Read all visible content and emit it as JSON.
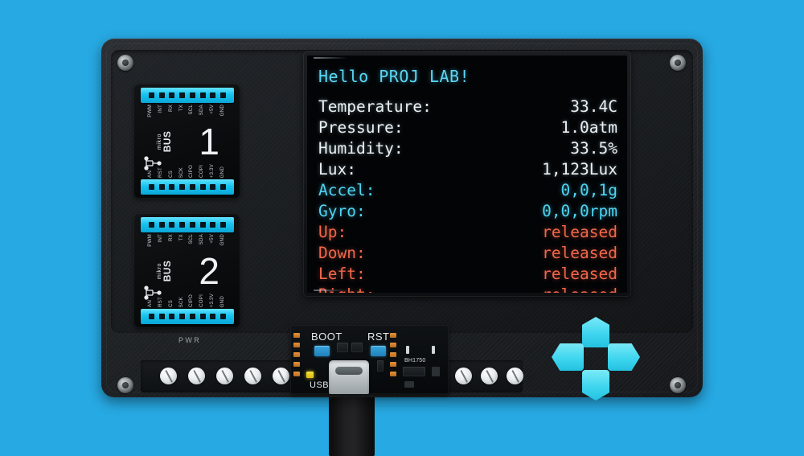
{
  "scene": {
    "background_color": "#27a9e3",
    "device_label": "3d-printed-dev-board-enclosure"
  },
  "display": {
    "title": "Hello PROJ LAB!",
    "rows": [
      {
        "label": "Temperature:",
        "value": "33.4C",
        "label_color": "white",
        "value_color": "white"
      },
      {
        "label": "Pressure:",
        "value": "1.0atm",
        "label_color": "white",
        "value_color": "white"
      },
      {
        "label": "Humidity:",
        "value": "33.5%",
        "label_color": "white",
        "value_color": "white"
      },
      {
        "label": "Lux:",
        "value": "1,123Lux",
        "label_color": "white",
        "value_color": "white"
      },
      {
        "label": "Accel:",
        "value": "0,0,1g",
        "label_color": "cyan",
        "value_color": "cyan"
      },
      {
        "label": "Gyro:",
        "value": "0,0,0rpm",
        "label_color": "cyan",
        "value_color": "cyan"
      },
      {
        "label": "Up:",
        "value": "released",
        "label_color": "red",
        "value_color": "red"
      },
      {
        "label": "Down:",
        "value": "released",
        "label_color": "red",
        "value_color": "red"
      },
      {
        "label": "Left:",
        "value": "released",
        "label_color": "red",
        "value_color": "red"
      },
      {
        "label": "Right:",
        "value": "released",
        "label_color": "red",
        "value_color": "red"
      }
    ],
    "colors": {
      "title": "#5ad7f5",
      "white": "#e9f1f5",
      "cyan": "#4fd4f2",
      "red": "#f2674a",
      "screen_bg": "#030406"
    }
  },
  "mikrobus": {
    "brand_small": "mikro",
    "brand_large": "BUS",
    "sockets": [
      {
        "number": "1",
        "top_pins": [
          "PWM",
          "INT",
          "RX",
          "TX",
          "SCL",
          "SDA",
          "+5V",
          "GND"
        ],
        "bottom_pins": [
          "AN",
          "RST",
          "CS",
          "SCK",
          "CIPO",
          "COPI",
          "+3.3V",
          "GND"
        ]
      },
      {
        "number": "2",
        "top_pins": [
          "PWM",
          "INT",
          "RX",
          "TX",
          "SCL",
          "SDA",
          "+5V",
          "GND"
        ],
        "bottom_pins": [
          "AN",
          "RST",
          "CS",
          "SCK",
          "CIPO",
          "COPI",
          "+3.3V",
          "GND"
        ]
      }
    ],
    "header_color": "#17c3ef"
  },
  "pcb": {
    "boot_label": "BOOT",
    "rst_label": "RST",
    "usb_label": "USB",
    "sensor_label": "BH1750",
    "connector": "usb-c"
  },
  "enclosure": {
    "pwr_label": "PWR",
    "corner_screw_count": 4,
    "bottom_screw_count": 9
  },
  "dpad": {
    "buttons": [
      {
        "name": "up",
        "state": "released"
      },
      {
        "name": "down",
        "state": "released"
      },
      {
        "name": "left",
        "state": "released"
      },
      {
        "name": "right",
        "state": "released"
      }
    ],
    "color": "#3fd6ef"
  }
}
